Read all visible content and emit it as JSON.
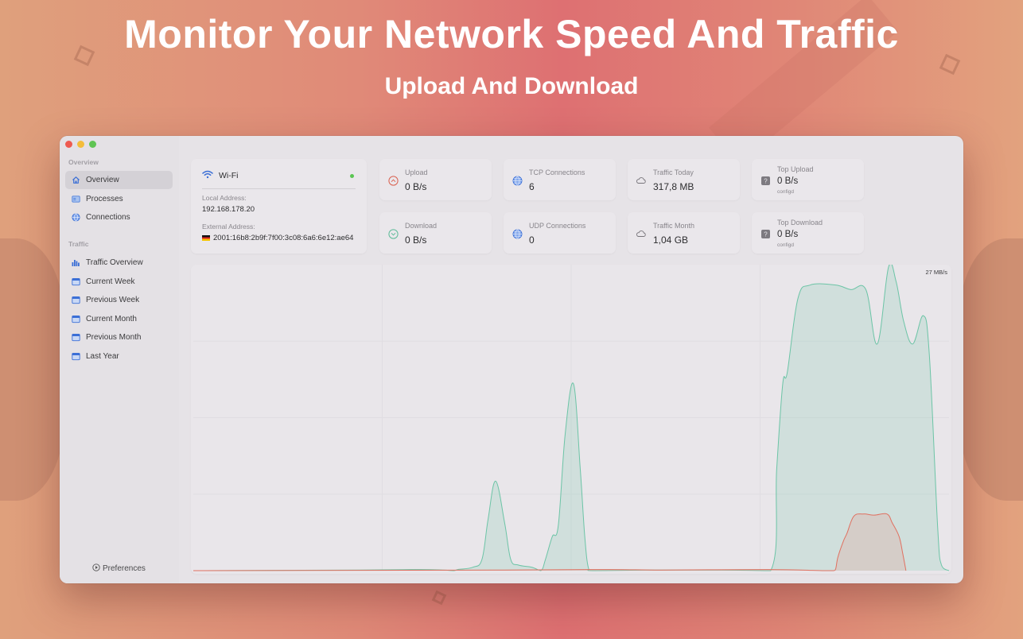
{
  "hero": {
    "title": "Monitor Your Network Speed And Traffic",
    "subtitle": "Upload And Download"
  },
  "sidebar": {
    "sections": [
      {
        "title": "Overview",
        "items": [
          {
            "label": "Overview",
            "icon": "house-icon",
            "active": true
          },
          {
            "label": "Processes",
            "icon": "processes-icon",
            "active": false
          },
          {
            "label": "Connections",
            "icon": "globe-icon",
            "active": false
          }
        ]
      },
      {
        "title": "Traffic",
        "items": [
          {
            "label": "Traffic Overview",
            "icon": "bar-chart-icon",
            "active": false
          },
          {
            "label": "Current Week",
            "icon": "calendar-icon",
            "active": false
          },
          {
            "label": "Previous Week",
            "icon": "calendar-icon",
            "active": false
          },
          {
            "label": "Current Month",
            "icon": "calendar-icon",
            "active": false
          },
          {
            "label": "Previous Month",
            "icon": "calendar-icon",
            "active": false
          },
          {
            "label": "Last Year",
            "icon": "calendar-icon",
            "active": false
          }
        ]
      }
    ],
    "preferences_label": "Preferences"
  },
  "wifi": {
    "name": "Wi-Fi",
    "status_color": "#5ac552",
    "local_label": "Local Address:",
    "local_value": "192.168.178.20",
    "external_label": "External Address:",
    "external_flag": "DE",
    "external_value": "2001:16b8:2b9f:7f00:3c08:6a6:6e12:ae64"
  },
  "stats": {
    "upload": {
      "label": "Upload",
      "value": "0 B/s",
      "icon": "upload-arrow-icon",
      "color": "#d9604f"
    },
    "download": {
      "label": "Download",
      "value": "0 B/s",
      "icon": "download-arrow-icon",
      "color": "#5dbb98"
    },
    "tcp": {
      "label": "TCP Connections",
      "value": "6",
      "icon": "globe-icon"
    },
    "udp": {
      "label": "UDP Connections",
      "value": "0",
      "icon": "globe-icon"
    },
    "traffic_today": {
      "label": "Traffic Today",
      "value": "317,8 MB",
      "icon": "cloud-icon"
    },
    "traffic_month": {
      "label": "Traffic Month",
      "value": "1,04 GB",
      "icon": "cloud-icon"
    },
    "top_upload": {
      "label": "Top Upload",
      "value": "0 B/s",
      "process": "configd",
      "icon": "unknown-app-icon"
    },
    "top_download": {
      "label": "Top Download",
      "value": "0 B/s",
      "process": "configd",
      "icon": "unknown-app-icon"
    }
  },
  "chart_data": {
    "type": "area",
    "title": "",
    "xlabel": "",
    "ylabel": "",
    "ymax_label": "27 MB/s",
    "ylim": [
      0,
      27
    ],
    "xlim": [
      0,
      100
    ],
    "grid": true,
    "series": [
      {
        "name": "Download",
        "color": "#6cc4a6",
        "fill": "rgba(120,200,175,0.22)",
        "points": [
          [
            0,
            0
          ],
          [
            22,
            0.05
          ],
          [
            30,
            0.1
          ],
          [
            33,
            0.05
          ],
          [
            34.5,
            0
          ],
          [
            35,
            0.1
          ],
          [
            37,
            0.3
          ],
          [
            38.2,
            1.0
          ],
          [
            39,
            4.5
          ],
          [
            40,
            7.9
          ],
          [
            41.2,
            4.2
          ],
          [
            42,
            1.0
          ],
          [
            43,
            0.5
          ],
          [
            44.8,
            0.3
          ],
          [
            46,
            0
          ],
          [
            46.6,
            1.0
          ],
          [
            47.5,
            3.0
          ],
          [
            48.3,
            4.0
          ],
          [
            49.2,
            12.0
          ],
          [
            50.3,
            16.5
          ],
          [
            51.2,
            9.0
          ],
          [
            51.8,
            3.0
          ],
          [
            52.3,
            0.2
          ],
          [
            53,
            0
          ],
          [
            60,
            0.05
          ],
          [
            70,
            0.05
          ],
          [
            76.4,
            0
          ],
          [
            77.2,
            9.0
          ],
          [
            78,
            16.5
          ],
          [
            78.6,
            17.5
          ],
          [
            80,
            24.0
          ],
          [
            81.6,
            25.2
          ],
          [
            85,
            25.2
          ],
          [
            87,
            24.8
          ],
          [
            89,
            24.8
          ],
          [
            90.5,
            20.0
          ],
          [
            92,
            26.8
          ],
          [
            93,
            25.5
          ],
          [
            94,
            22.0
          ],
          [
            95.2,
            20.0
          ],
          [
            96.6,
            22.5
          ],
          [
            97.4,
            19.0
          ],
          [
            98.5,
            3.8
          ],
          [
            99,
            0.5
          ],
          [
            100,
            0
          ]
        ],
        "x_note": "x is percent of visible time window"
      }
    ],
    "series_2": {
      "name": "Upload",
      "color": "#e07060",
      "fill": "rgba(230,140,130,0.22)"
    }
  }
}
